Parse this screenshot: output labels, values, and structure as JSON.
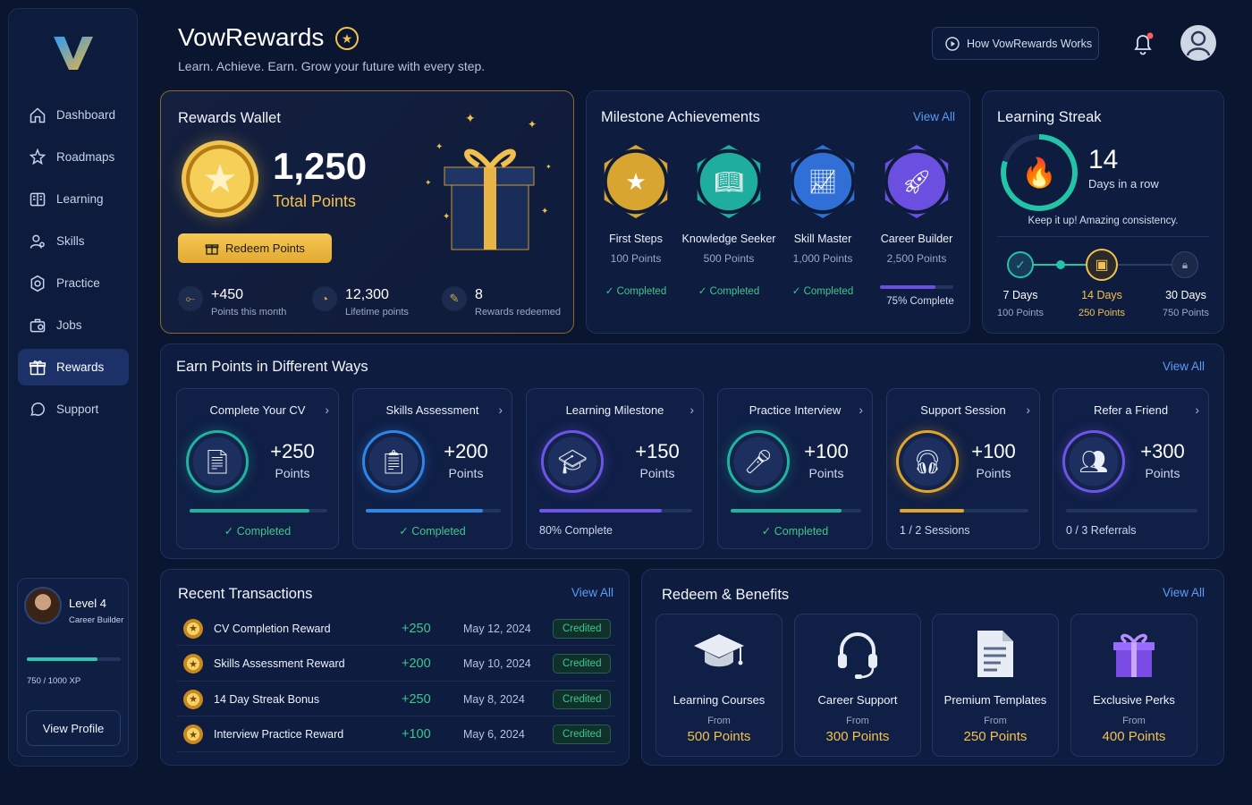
{
  "app": {
    "name": "VowRewards",
    "tagline": "Learn. Achieve. Earn. Grow your future with every step.",
    "how_label": "How VowRewards Works"
  },
  "sidebar": {
    "items": [
      {
        "label": "Dashboard",
        "icon": "home-icon"
      },
      {
        "label": "Roadmaps",
        "icon": "star-path-icon"
      },
      {
        "label": "Learning",
        "icon": "book-icon"
      },
      {
        "label": "Skills",
        "icon": "user-skill-icon"
      },
      {
        "label": "Practice",
        "icon": "target-icon"
      },
      {
        "label": "Jobs",
        "icon": "briefcase-icon"
      },
      {
        "label": "Rewards",
        "icon": "gift-icon"
      },
      {
        "label": "Support",
        "icon": "chat-icon"
      }
    ],
    "active": "Rewards",
    "profile": {
      "level": "Level 4",
      "role": "Career Builder",
      "xp": "750 / 1000 XP",
      "xp_progress": 0.75,
      "button": "View Profile"
    }
  },
  "wallet": {
    "title": "Rewards Wallet",
    "points": "1,250",
    "points_label": "Total Points",
    "redeem_label": "Redeem Points",
    "stats": [
      {
        "value": "+450",
        "label": "Points this month"
      },
      {
        "value": "12,300",
        "label": "Lifetime points"
      },
      {
        "value": "8",
        "label": "Rewards redeemed"
      }
    ]
  },
  "milestones": {
    "title": "Milestone Achievements",
    "view_all": "View All",
    "items": [
      {
        "name": "First Steps",
        "points": "100 Points",
        "status": "Completed",
        "color": "#d9a531"
      },
      {
        "name": "Knowledge Seeker",
        "points": "500 Points",
        "status": "Completed",
        "color": "#1fae9d"
      },
      {
        "name": "Skill Master",
        "points": "1,000 Points",
        "status": "Completed",
        "color": "#2f6fd6"
      },
      {
        "name": "Career Builder",
        "points": "2,500 Points",
        "status": "75% Complete",
        "progress": 0.75,
        "color": "#6a4fe0"
      }
    ]
  },
  "streak": {
    "title": "Learning Streak",
    "days": "14",
    "days_label": "Days in a row",
    "message": "Keep it up! Amazing consistency.",
    "steps": [
      {
        "days": "7 Days",
        "points": "100 Points"
      },
      {
        "days": "14 Days",
        "points": "250 Points"
      },
      {
        "days": "30 Days",
        "points": "750 Points"
      }
    ]
  },
  "earn": {
    "title": "Earn Points in Different Ways",
    "view_all": "View All",
    "items": [
      {
        "title": "Complete Your CV",
        "points": "+250",
        "unit": "Points",
        "status": "Completed",
        "progress": 0.87,
        "color": "#1fb3a0"
      },
      {
        "title": "Skills Assessment",
        "points": "+200",
        "unit": "Points",
        "status": "Completed",
        "progress": 0.87,
        "color": "#2f86e6"
      },
      {
        "title": "Learning Milestone",
        "points": "+150",
        "unit": "Points",
        "status": "80% Complete",
        "progress": 0.8,
        "color": "#6d55e8"
      },
      {
        "title": "Practice Interview",
        "points": "+100",
        "unit": "Points",
        "status": "Completed",
        "progress": 0.85,
        "color": "#1fb3a0"
      },
      {
        "title": "Support Session",
        "points": "+100",
        "unit": "Points",
        "status": "1 / 2 Sessions",
        "progress": 0.5,
        "color": "#e2a52b"
      },
      {
        "title": "Refer a Friend",
        "points": "+300",
        "unit": "Points",
        "status": "0 / 3 Referrals",
        "progress": 0.0,
        "color": "#6d55e8"
      }
    ]
  },
  "transactions": {
    "title": "Recent Transactions",
    "view_all": "View All",
    "rows": [
      {
        "name": "CV Completion Reward",
        "amount": "+250",
        "date": "May 12, 2024",
        "status": "Credited"
      },
      {
        "name": "Skills Assessment Reward",
        "amount": "+200",
        "date": "May 10, 2024",
        "status": "Credited"
      },
      {
        "name": "14 Day Streak Bonus",
        "amount": "+250",
        "date": "May 8, 2024",
        "status": "Credited"
      },
      {
        "name": "Interview Practice Reward",
        "amount": "+100",
        "date": "May 6, 2024",
        "status": "Credited"
      }
    ]
  },
  "redeem": {
    "title": "Redeem & Benefits",
    "view_all": "View All",
    "items": [
      {
        "title": "Learning Courses",
        "from": "From",
        "points": "500 Points"
      },
      {
        "title": "Career Support",
        "from": "From",
        "points": "300 Points"
      },
      {
        "title": "Premium Templates",
        "from": "From",
        "points": "250 Points"
      },
      {
        "title": "Exclusive Perks",
        "from": "From",
        "points": "400 Points"
      }
    ]
  }
}
